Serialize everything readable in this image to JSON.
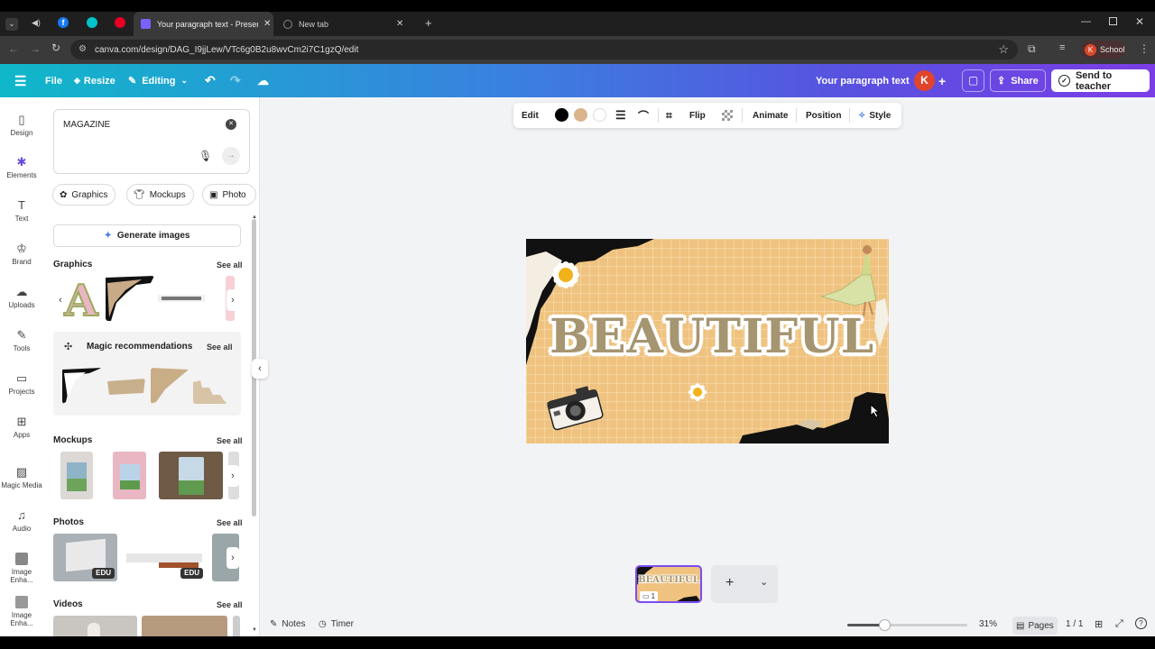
{
  "browser": {
    "tabs": [
      {
        "label": "Your paragraph text - Presentati",
        "active": true
      },
      {
        "label": "New tab",
        "active": false
      }
    ],
    "url": "canva.com/design/DAG_I9jjLew/VTc6g0B2u8wvCm2i7C1gzQ/edit",
    "profile_label": "School",
    "profile_initial": "K"
  },
  "header": {
    "file_label": "File",
    "resize_label": "Resize",
    "editing_label": "Editing",
    "doc_title": "Your paragraph text",
    "avatar_initial": "K",
    "share_label": "Share",
    "send_label": "Send to teacher",
    "colors": {
      "start": "#0fb8c9",
      "end": "#7b3ee6"
    }
  },
  "rail": [
    {
      "label": "Design",
      "icon": "design-icon"
    },
    {
      "label": "Elements",
      "icon": "elements-icon"
    },
    {
      "label": "Text",
      "icon": "text-icon"
    },
    {
      "label": "Brand",
      "icon": "brand-icon"
    },
    {
      "label": "Uploads",
      "icon": "uploads-icon"
    },
    {
      "label": "Tools",
      "icon": "tools-icon"
    },
    {
      "label": "Projects",
      "icon": "projects-icon"
    },
    {
      "label": "Apps",
      "icon": "apps-icon"
    },
    {
      "label": "Magic Media",
      "icon": "magic-media-icon"
    },
    {
      "label": "Audio",
      "icon": "audio-icon"
    },
    {
      "label": "Image Enha...",
      "icon": "image-enhance-icon"
    },
    {
      "label": "Image Enha...",
      "icon": "image-enhance-icon"
    }
  ],
  "panel": {
    "search_value": "MAGAZINE",
    "chips": [
      "Graphics",
      "Mockups",
      "Photo"
    ],
    "generate_label": "Generate images",
    "sections": {
      "graphics": "Graphics",
      "magic": "Magic recommendations",
      "mockups": "Mockups",
      "photos": "Photos",
      "videos": "Videos"
    },
    "see_all": "See all",
    "edu_badge": "EDU"
  },
  "toolbar": {
    "edit": "Edit",
    "flip": "Flip",
    "animate": "Animate",
    "position": "Position",
    "style": "Style",
    "swatches": [
      "#000000",
      "#d9b48a",
      "#ffffff"
    ]
  },
  "canvas": {
    "headline": "BEAUTIFUL",
    "bg_color": "#efc37f"
  },
  "pages": {
    "thumb_word": "BEAUTIFUL",
    "page_number": "1",
    "counter": "1 / 1",
    "pages_label": "Pages"
  },
  "bottom": {
    "notes": "Notes",
    "timer": "Timer",
    "zoom": "31%",
    "zoom_level": 0.31
  }
}
